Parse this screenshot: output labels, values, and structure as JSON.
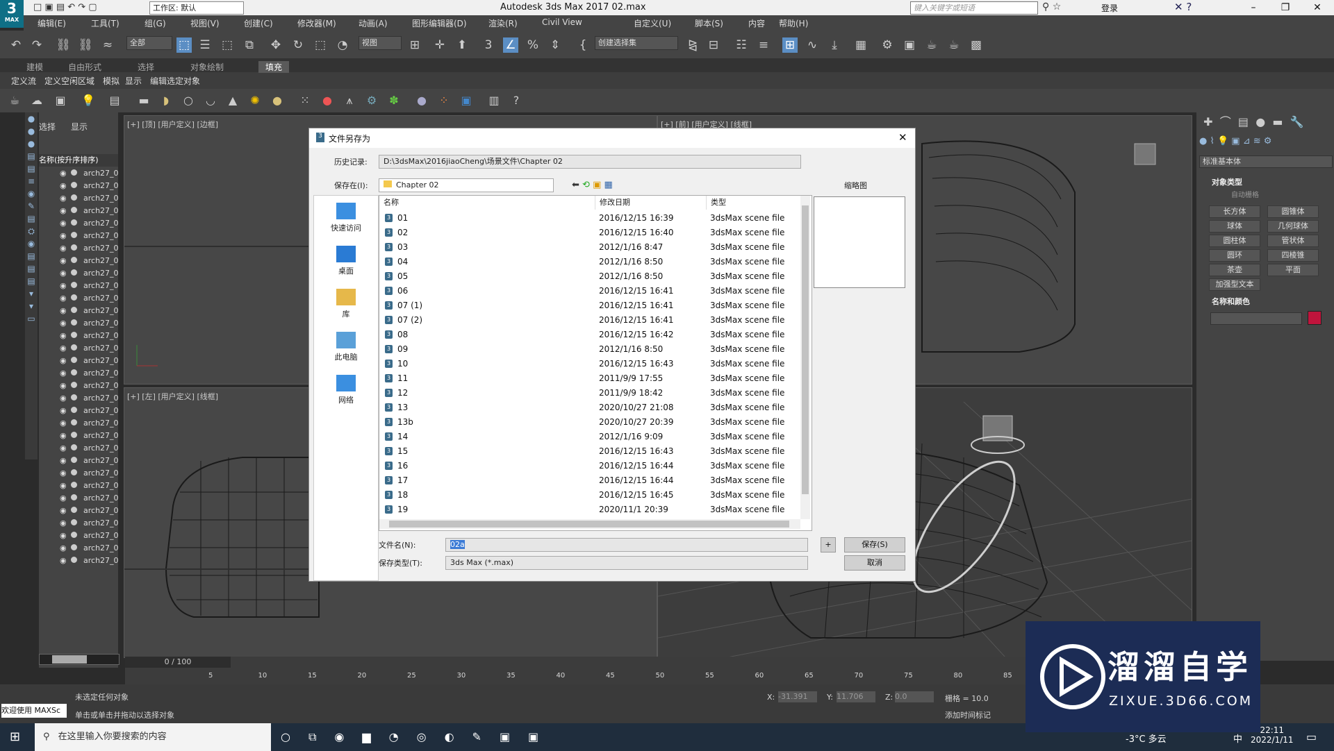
{
  "titlebar": {
    "workspace": "工作区: 默认",
    "title": "Autodesk 3ds Max 2017      02.max",
    "search_placeholder": "键入关键字或短语",
    "login": "登录"
  },
  "menu": [
    "编辑(E)",
    "工具(T)",
    "组(G)",
    "视图(V)",
    "创建(C)",
    "修改器(M)",
    "动画(A)",
    "图形编辑器(D)",
    "渲染(R)",
    "Civil View",
    "自定义(U)",
    "脚本(S)",
    "内容",
    "帮助(H)"
  ],
  "toolbar": {
    "filter": "全部",
    "view_select": "视图",
    "selection_set": "创建选择集"
  },
  "ribbon": {
    "tabs": [
      "建模",
      "自由形式",
      "选择",
      "对象绘制",
      "填充"
    ],
    "active_tab": "填充",
    "sub": [
      "定义流",
      "定义空闲区域",
      "模拟",
      "显示",
      "编辑选定对象"
    ]
  },
  "scene_explorer": {
    "tabs": [
      "选择",
      "显示"
    ],
    "column": "名称(按升序排序)",
    "row_label": "arch27_0",
    "row_count": 32
  },
  "viewports": {
    "top_label": "[+] [顶] [用户定义] [边框]",
    "front_label": "[+] [前] [用户定义] [线框]",
    "left_label": "[+] [左] [用户定义] [线框]"
  },
  "command_panel": {
    "dropdown": "标准基本体",
    "object_type_title": "对象类型",
    "autogrid": "自动栅格",
    "buttons": [
      "长方体",
      "圆锥体",
      "球体",
      "几何球体",
      "圆柱体",
      "管状体",
      "圆环",
      "四棱锥",
      "茶壶",
      "平面",
      "加强型文本"
    ],
    "name_color_title": "名称和颜色",
    "object_color": "#c0143c"
  },
  "dialog": {
    "title": "文件另存为",
    "history_label": "历史记录:",
    "history_value": "D:\\3dsMax\\2016jiaoCheng\\场景文件\\Chapter 02",
    "save_in_label": "保存在(I):",
    "save_in_value": "Chapter 02",
    "thumbnail_label": "缩略图",
    "places": [
      "快速访问",
      "桌面",
      "库",
      "此电脑",
      "网络"
    ],
    "columns": {
      "name": "名称",
      "date": "修改日期",
      "type": "类型"
    },
    "files": [
      {
        "name": "01",
        "date": "2016/12/15 16:39",
        "type": "3dsMax scene file"
      },
      {
        "name": "02",
        "date": "2016/12/15 16:40",
        "type": "3dsMax scene file"
      },
      {
        "name": "03",
        "date": "2012/1/16 8:47",
        "type": "3dsMax scene file"
      },
      {
        "name": "04",
        "date": "2012/1/16 8:50",
        "type": "3dsMax scene file"
      },
      {
        "name": "05",
        "date": "2012/1/16 8:50",
        "type": "3dsMax scene file"
      },
      {
        "name": "06",
        "date": "2016/12/15 16:41",
        "type": "3dsMax scene file"
      },
      {
        "name": "07 (1)",
        "date": "2016/12/15 16:41",
        "type": "3dsMax scene file"
      },
      {
        "name": "07 (2)",
        "date": "2016/12/15 16:41",
        "type": "3dsMax scene file"
      },
      {
        "name": "08",
        "date": "2016/12/15 16:42",
        "type": "3dsMax scene file"
      },
      {
        "name": "09",
        "date": "2012/1/16 8:50",
        "type": "3dsMax scene file"
      },
      {
        "name": "10",
        "date": "2016/12/15 16:43",
        "type": "3dsMax scene file"
      },
      {
        "name": "11",
        "date": "2011/9/9 17:55",
        "type": "3dsMax scene file"
      },
      {
        "name": "12",
        "date": "2011/9/9 18:42",
        "type": "3dsMax scene file"
      },
      {
        "name": "13",
        "date": "2020/10/27 21:08",
        "type": "3dsMax scene file"
      },
      {
        "name": "13b",
        "date": "2020/10/27 20:39",
        "type": "3dsMax scene file"
      },
      {
        "name": "14",
        "date": "2012/1/16 9:09",
        "type": "3dsMax scene file"
      },
      {
        "name": "15",
        "date": "2016/12/15 16:43",
        "type": "3dsMax scene file"
      },
      {
        "name": "16",
        "date": "2016/12/15 16:44",
        "type": "3dsMax scene file"
      },
      {
        "name": "17",
        "date": "2016/12/15 16:44",
        "type": "3dsMax scene file"
      },
      {
        "name": "18",
        "date": "2016/12/15 16:45",
        "type": "3dsMax scene file"
      },
      {
        "name": "19",
        "date": "2020/11/1 20:39",
        "type": "3dsMax scene file"
      }
    ],
    "filename_label": "文件名(N):",
    "filename_value": "02a",
    "filetype_label": "保存类型(T):",
    "filetype_value": "3ds Max (*.max)",
    "plus": "+",
    "save_button": "保存(S)",
    "cancel_button": "取消"
  },
  "timeline": {
    "frame": "0 / 100",
    "ticks": [
      "5",
      "10",
      "15",
      "20",
      "25",
      "30",
      "35",
      "40",
      "45",
      "50",
      "55",
      "60",
      "65",
      "70",
      "75",
      "80",
      "85"
    ]
  },
  "status": {
    "welcome": "欢迎使用 MAXSc",
    "line1": "未选定任何对象",
    "line2": "单击或单击并拖动以选择对象",
    "x_label": "X:",
    "x_value": "-31.391",
    "y_label": "Y:",
    "y_value": "11.706",
    "z_label": "Z:",
    "z_value": "0.0",
    "grid": "栅格 = 10.0",
    "add_tag": "添加时间标记"
  },
  "taskbar": {
    "search_placeholder": "在这里输入你要搜索的内容",
    "weather": "-3°C 多云",
    "ime": "中",
    "time": "22:11",
    "date": "2022/1/11"
  },
  "watermark": {
    "text": "溜溜自学",
    "url": "ZIXUE.3D66.COM"
  }
}
